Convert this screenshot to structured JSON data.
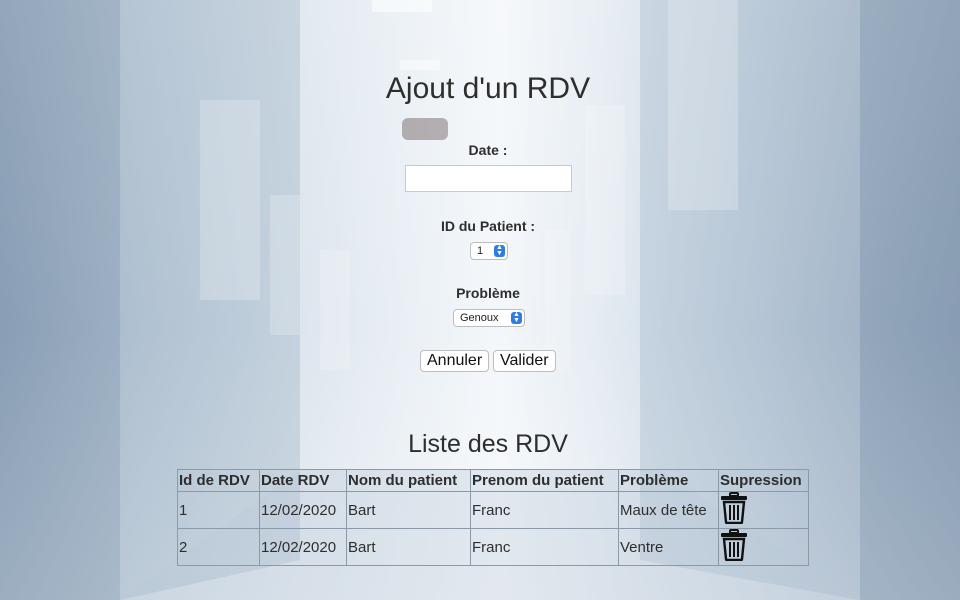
{
  "form": {
    "title": "Ajout d'un RDV",
    "date_label": "Date :",
    "date_value": "",
    "patient_label": "ID du Patient :",
    "patient_selected": "1",
    "problem_label": "Problème",
    "problem_selected": "Genoux",
    "cancel_label": "Annuler",
    "submit_label": "Valider"
  },
  "list": {
    "title": "Liste des RDV",
    "columns": [
      "Id de RDV",
      "Date RDV",
      "Nom du patient",
      "Prenom du patient",
      "Problème",
      "Supression"
    ],
    "rows": [
      {
        "id": "1",
        "date": "12/02/2020",
        "nom": "Bart",
        "prenom": "Franc",
        "probleme": "Maux de tête",
        "delete_icon": "trash-icon"
      },
      {
        "id": "2",
        "date": "12/02/2020",
        "nom": "Bart",
        "prenom": "Franc",
        "probleme": "Ventre",
        "delete_icon": "trash-icon"
      }
    ]
  },
  "icons": {
    "select_chevron": "chevron-updown-icon",
    "delete": "trash-icon"
  },
  "colors": {
    "select_accent": "#2f7de1",
    "text": "#2e2e2e"
  }
}
